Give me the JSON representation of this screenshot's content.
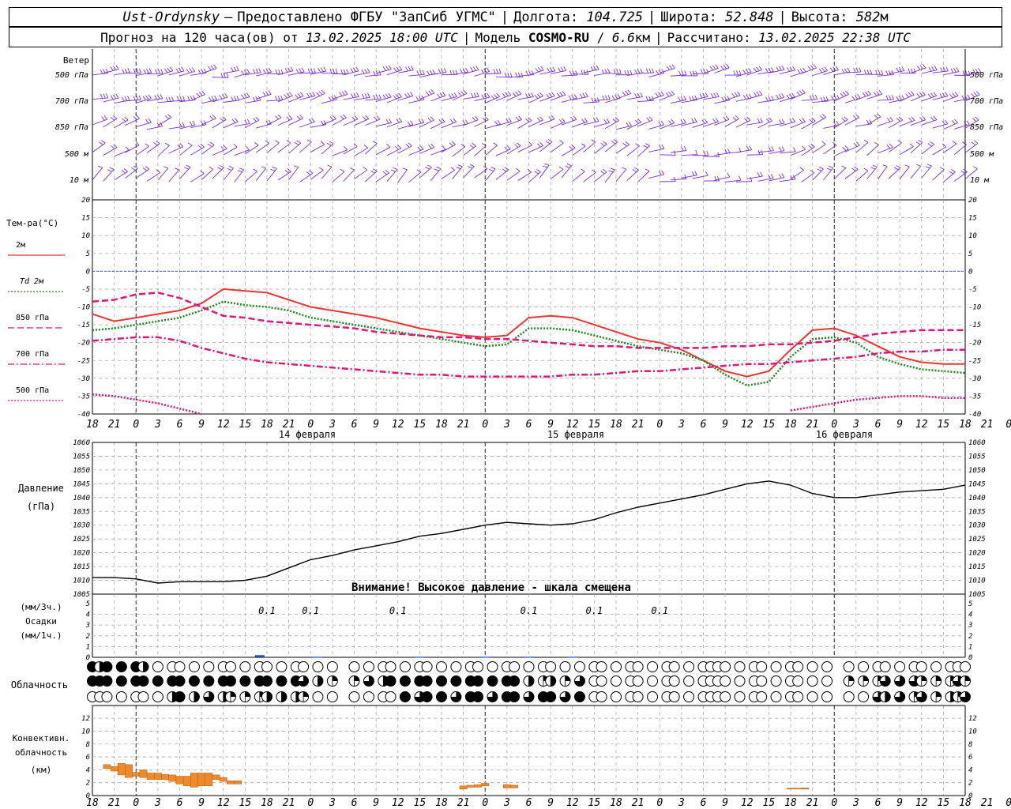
{
  "header": {
    "station": "Ust-Ordynsky",
    "provider": "Предоставлено ФГБУ \"ЗапСиб УГМС\"",
    "lon_label": "Долгота:",
    "lon": "104.725",
    "lat_label": "Широта:",
    "lat": "52.848",
    "alt_label": "Высота:",
    "alt": "582",
    "alt_unit": "м",
    "forecast_label": "Прогноз на 120 часа(ов) от",
    "forecast_from": "13.02.2025 18:00 UTC",
    "model_label": "Модель",
    "model": "COSMO-RU",
    "model_res": "6.6",
    "model_res_unit": "км",
    "calc_label": "Рассчитано:",
    "calc_time": "13.02.2025 22:38 UTC"
  },
  "wind_panel": {
    "title": "Ветер",
    "levels": [
      "500 гПа",
      "700 гПа",
      "850 гПа",
      "500 м",
      "10 м"
    ],
    "color": "#7b2fd6"
  },
  "temp_panel": {
    "title": "Тем-ра(°С)",
    "legend": [
      {
        "label": "2м",
        "color": "#ee3333",
        "style": "solid"
      },
      {
        "label": "Td  2м",
        "color": "#1a8a1a",
        "style": "dotted"
      },
      {
        "label": "850 гПа",
        "color": "#e0157a",
        "style": "dashed"
      },
      {
        "label": "700 гПа",
        "color": "#e0157a",
        "style": "dashdot"
      },
      {
        "label": "500 гПа",
        "color": "#e0157a",
        "style": "dotted"
      }
    ],
    "date_labels": [
      "14 февраля",
      "15 февраля",
      "16 февраля"
    ]
  },
  "pressure_panel": {
    "title": "Давление",
    "unit": "(гПа)",
    "warning": "Внимание! Высокое давление - шкала смещена"
  },
  "precip_panel": {
    "label1": "(мм/3ч.)",
    "label2": "Осадки",
    "label3": "(мм/1ч.)",
    "values": [
      "0.1",
      "0.1",
      "0.1",
      "0.1",
      "0.1",
      "0.1"
    ]
  },
  "cloud_panel": {
    "title": "Облачность"
  },
  "conv_panel": {
    "title1": "Конвективн.",
    "title2": "облачность",
    "title3": "(км)"
  },
  "chart_data": [
    {
      "type": "line",
      "title": "Тем-ра(°С)",
      "ylim": [
        -40,
        20
      ],
      "x_hours_from_forecast_start": [
        0,
        3,
        6,
        9,
        12,
        15,
        18,
        21,
        24,
        27,
        30,
        33,
        36,
        39,
        42,
        45,
        48,
        51,
        54,
        57,
        60,
        63,
        66,
        69,
        72,
        75,
        78,
        81,
        84,
        87,
        90,
        93,
        96,
        99,
        102,
        105,
        108,
        111,
        114,
        117,
        120
      ],
      "x_tick_labels": [
        "18",
        "21",
        "0",
        "3",
        "6",
        "9",
        "12",
        "15",
        "18",
        "21",
        "0",
        "3",
        "6",
        "9",
        "12",
        "15",
        "18",
        "21",
        "0",
        "3",
        "6",
        "9",
        "12",
        "15",
        "18",
        "21",
        "0",
        "3",
        "6",
        "9",
        "12",
        "15",
        "18",
        "21",
        "0",
        "3",
        "6",
        "9",
        "12",
        "15",
        "18",
        "21",
        "0"
      ],
      "series": [
        {
          "name": "2м",
          "values": [
            -12,
            -14,
            -13,
            -12,
            -11,
            -9,
            -5,
            -5.5,
            -6,
            -8,
            -10,
            -11,
            -12,
            -13,
            -14.5,
            -16,
            -17,
            -18,
            -18.5,
            -18,
            -13,
            -12.5,
            -13,
            -15,
            -17,
            -19,
            -20,
            -22,
            -25,
            -28,
            -29.5,
            -28,
            -22,
            -16.5,
            -16,
            -18,
            -21,
            -24,
            -25.5,
            -26,
            -26
          ]
        },
        {
          "name": "Td  2м",
          "values": [
            -16.5,
            -16,
            -15,
            -14,
            -13,
            -11,
            -8.5,
            -9.5,
            -10,
            -11,
            -13,
            -14,
            -15,
            -16,
            -17,
            -18,
            -19,
            -20,
            -21,
            -20.5,
            -16,
            -16,
            -16.5,
            -18,
            -19.5,
            -21,
            -22,
            -23,
            -25,
            -29,
            -32,
            -31,
            -24,
            -19,
            -18.5,
            -20,
            -24,
            -26,
            -27.5,
            -28,
            -28.5
          ]
        },
        {
          "name": "850 гПа",
          "values": [
            -8.5,
            -8,
            -6.5,
            -6,
            -7.5,
            -10,
            -12.5,
            -13,
            -14,
            -14.5,
            -15,
            -15.5,
            -16,
            -17,
            -17.5,
            -18,
            -18.5,
            -18.5,
            -19,
            -19,
            -19.5,
            -20,
            -20.5,
            -21,
            -21,
            -21.5,
            -21.5,
            -21.5,
            -21.5,
            -21,
            -21,
            -20.5,
            -20.5,
            -20,
            -19.5,
            -18.5,
            -17.5,
            -17,
            -16.5,
            -16.5,
            -16.5
          ]
        },
        {
          "name": "700 гПа",
          "values": [
            -19.5,
            -19,
            -18.5,
            -18.5,
            -19.5,
            -21.5,
            -23,
            -24.5,
            -25.5,
            -26,
            -26.5,
            -27,
            -27.5,
            -28,
            -28.5,
            -29,
            -29,
            -29.5,
            -29.5,
            -29.5,
            -29.5,
            -29.5,
            -29,
            -29,
            -28.5,
            -28,
            -28,
            -27.5,
            -27,
            -26.5,
            -26,
            -26,
            -25.5,
            -25,
            -24.5,
            -24,
            -23,
            -22.5,
            -22.5,
            -22,
            -22
          ]
        },
        {
          "name": "500 гПа",
          "values": [
            -34.5,
            -35,
            -36,
            -37,
            -38.5,
            -40,
            null,
            null,
            null,
            null,
            null,
            null,
            null,
            null,
            null,
            null,
            null,
            null,
            null,
            null,
            null,
            null,
            null,
            null,
            null,
            null,
            null,
            null,
            null,
            null,
            null,
            null,
            -39,
            -38,
            -37,
            -36,
            -35.5,
            -35,
            -35,
            -35.5,
            -35.5
          ]
        }
      ]
    },
    {
      "type": "line",
      "title": "Давление",
      "ylim": [
        1005,
        1060
      ],
      "x_hours_from_forecast_start": [
        0,
        3,
        6,
        9,
        12,
        15,
        18,
        21,
        24,
        27,
        30,
        33,
        36,
        39,
        42,
        45,
        48,
        51,
        54,
        57,
        60,
        63,
        66,
        69,
        72,
        75,
        78,
        81,
        84,
        87,
        90,
        93,
        96,
        99,
        102,
        105,
        108,
        111,
        114,
        117,
        120
      ],
      "series": [
        {
          "name": "",
          "values": [
            1011,
            1011,
            1010.5,
            1009,
            1009.5,
            1009.5,
            1009.5,
            1010,
            1011.5,
            1014.5,
            1017.5,
            1019,
            1021,
            1022.5,
            1024,
            1026,
            1027,
            1028.5,
            1030,
            1031,
            1030.5,
            1030,
            1030.5,
            1032,
            1034.5,
            1036.5,
            1038,
            1039.5,
            1041,
            1043,
            1045,
            1046,
            1044.5,
            1041.5,
            1040,
            1040,
            1041,
            1042,
            1042.5,
            1043,
            1044.5
          ]
        }
      ]
    },
    {
      "type": "bar",
      "title": "Осадки",
      "ylim": [
        0,
        5
      ],
      "x_hours_from_forecast_start": [
        23,
        31,
        45,
        54,
        60,
        66
      ],
      "values": [
        0.2,
        0.05,
        0.05,
        0.05,
        0.05,
        0.05
      ]
    },
    {
      "type": "bar",
      "title": "Конвективн. облачность (км)",
      "ylim": [
        0,
        13
      ],
      "bars": [
        {
          "h": 2,
          "base": 4.2,
          "top": 4.8
        },
        {
          "h": 3,
          "base": 3.8,
          "top": 4.5
        },
        {
          "h": 4,
          "base": 3.2,
          "top": 5
        },
        {
          "h": 5,
          "base": 2.8,
          "top": 4.8
        },
        {
          "h": 6,
          "base": 3,
          "top": 3.6
        },
        {
          "h": 7,
          "base": 2.8,
          "top": 4
        },
        {
          "h": 8,
          "base": 2.5,
          "top": 3.5
        },
        {
          "h": 9,
          "base": 2.5,
          "top": 3.5
        },
        {
          "h": 10,
          "base": 2.5,
          "top": 3.3
        },
        {
          "h": 11,
          "base": 2.2,
          "top": 3.2
        },
        {
          "h": 12,
          "base": 1.8,
          "top": 3
        },
        {
          "h": 13,
          "base": 1.5,
          "top": 3
        },
        {
          "h": 14,
          "base": 1.3,
          "top": 3.5
        },
        {
          "h": 15,
          "base": 1.5,
          "top": 3.5
        },
        {
          "h": 16,
          "base": 1.5,
          "top": 3.5
        },
        {
          "h": 17,
          "base": 2.5,
          "top": 3.2
        },
        {
          "h": 18,
          "base": 2.2,
          "top": 2.8
        },
        {
          "h": 19,
          "base": 1.8,
          "top": 2.3
        },
        {
          "h": 20,
          "base": 1.8,
          "top": 2.3
        },
        {
          "h": 51,
          "base": 1,
          "top": 1.5
        },
        {
          "h": 52,
          "base": 1.3,
          "top": 1.6
        },
        {
          "h": 53,
          "base": 1.3,
          "top": 1.7
        },
        {
          "h": 54,
          "base": 1.5,
          "top": 1.9
        },
        {
          "h": 57,
          "base": 1.2,
          "top": 1.7
        },
        {
          "h": 58,
          "base": 1.2,
          "top": 1.6
        },
        {
          "h": 96,
          "base": 1,
          "top": 1.15
        },
        {
          "h": 97,
          "base": 1,
          "top": 1.15
        },
        {
          "h": 98,
          "base": 1,
          "top": 1.2
        }
      ]
    }
  ]
}
